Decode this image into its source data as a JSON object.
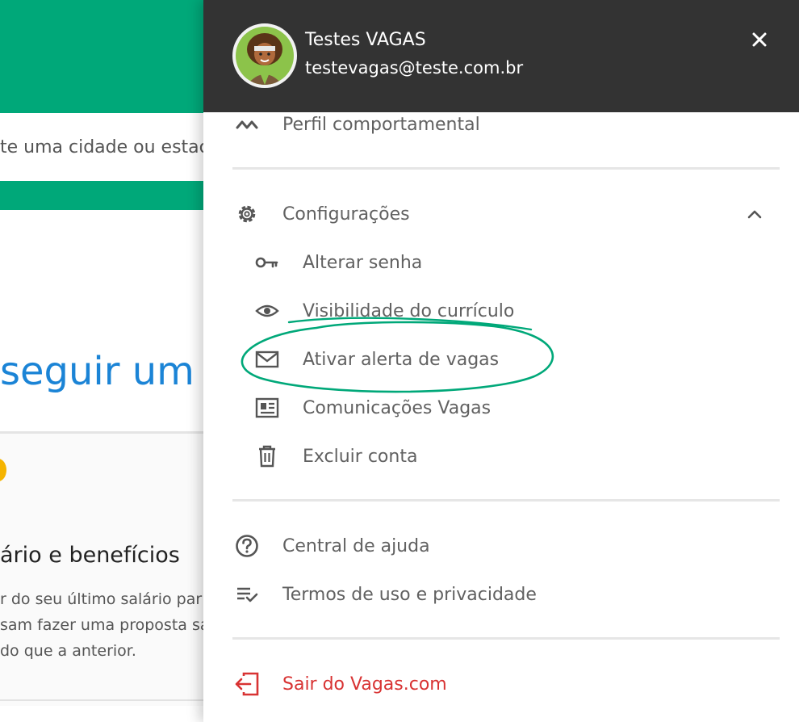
{
  "background": {
    "search_text": "te uma cidade ou estac",
    "headline": "seguir um er",
    "card_title": "ário e benefícios",
    "card_desc_lines": [
      "r do seu último salário par",
      "sam fazer uma proposta sa",
      " do que a anterior."
    ]
  },
  "drawer": {
    "user": {
      "name": "Testes VAGAS",
      "email": "testevagas@teste.com.br"
    },
    "close_icon": "close-icon",
    "items": {
      "behavioral_profile": "Perfil comportamental",
      "settings": "Configurações",
      "change_password": "Alterar senha",
      "resume_visibility": "Visibilidade do currículo",
      "job_alert": "Ativar alerta de vagas",
      "communications": "Comunicações Vagas",
      "delete_account": "Excluir conta",
      "help_center": "Central de ajuda",
      "terms": "Termos de uso e privacidade",
      "logout": "Sair do Vagas.com"
    }
  },
  "colors": {
    "brand_green": "#00a879",
    "header_dark": "#333333",
    "link_blue": "#1b84d6",
    "logout_red": "#d83333",
    "annotation_green": "#00a879"
  }
}
